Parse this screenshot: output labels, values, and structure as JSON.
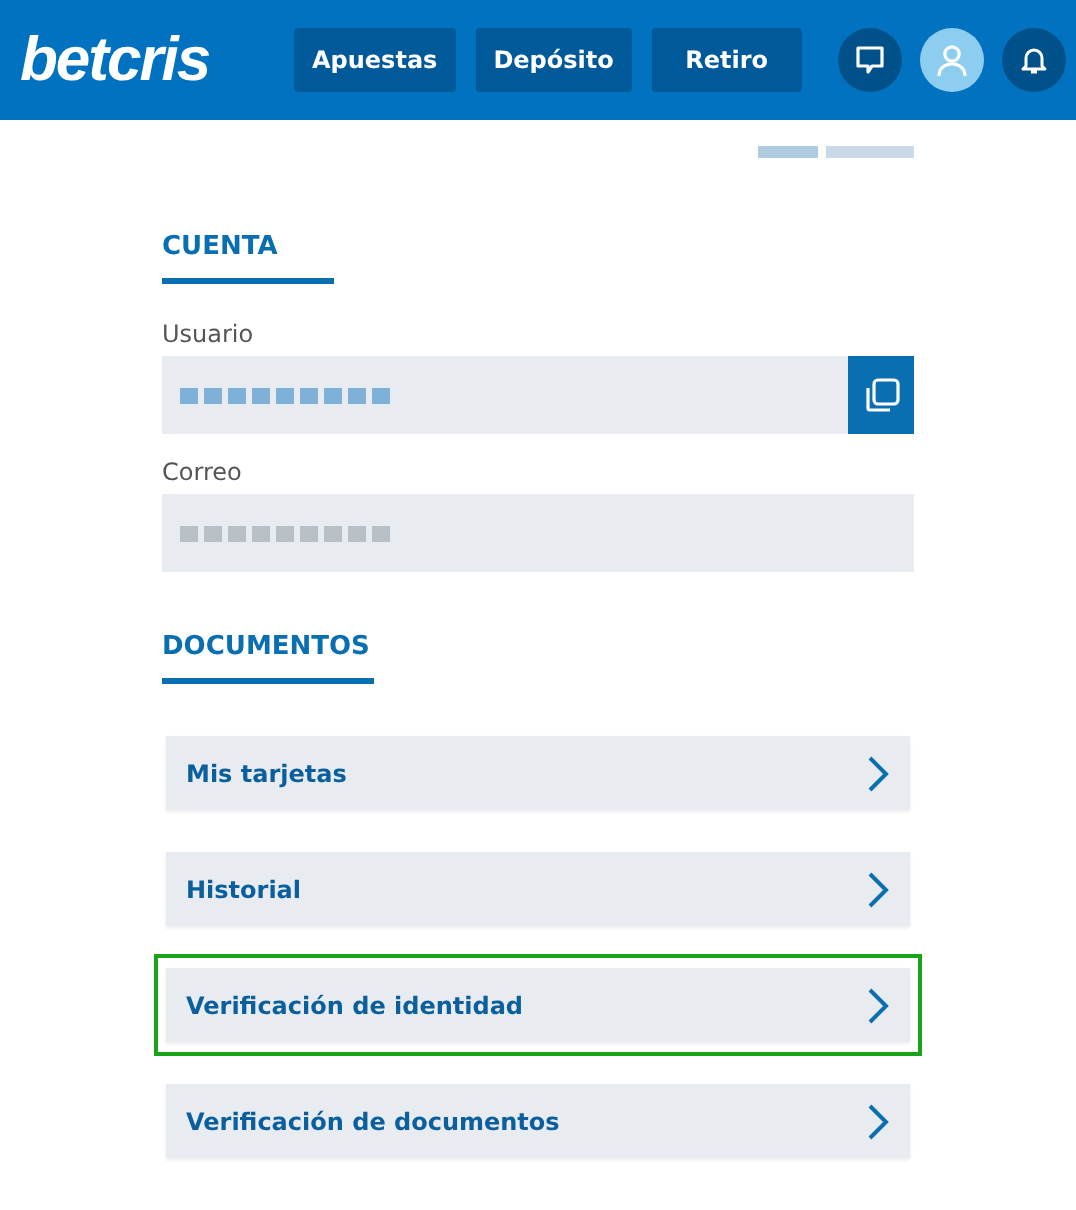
{
  "header": {
    "logo": "betcris",
    "nav": [
      {
        "label": "Apuestas"
      },
      {
        "label": "Depósito"
      },
      {
        "label": "Retiro"
      }
    ],
    "icons": [
      {
        "kind": "chat",
        "active": false
      },
      {
        "kind": "user",
        "active": true
      },
      {
        "kind": "bell",
        "active": false
      }
    ]
  },
  "account": {
    "title": "CUENTA",
    "fields": [
      {
        "label": "Usuario",
        "copyable": true
      },
      {
        "label": "Correo",
        "copyable": false
      }
    ]
  },
  "documents": {
    "title": "DOCUMENTOS",
    "items": [
      {
        "label": "Mis tarjetas",
        "highlighted": false
      },
      {
        "label": "Historial",
        "highlighted": false
      },
      {
        "label": "Verificación de identidad",
        "highlighted": true
      },
      {
        "label": "Verificación de documentos",
        "highlighted": false
      }
    ]
  }
}
